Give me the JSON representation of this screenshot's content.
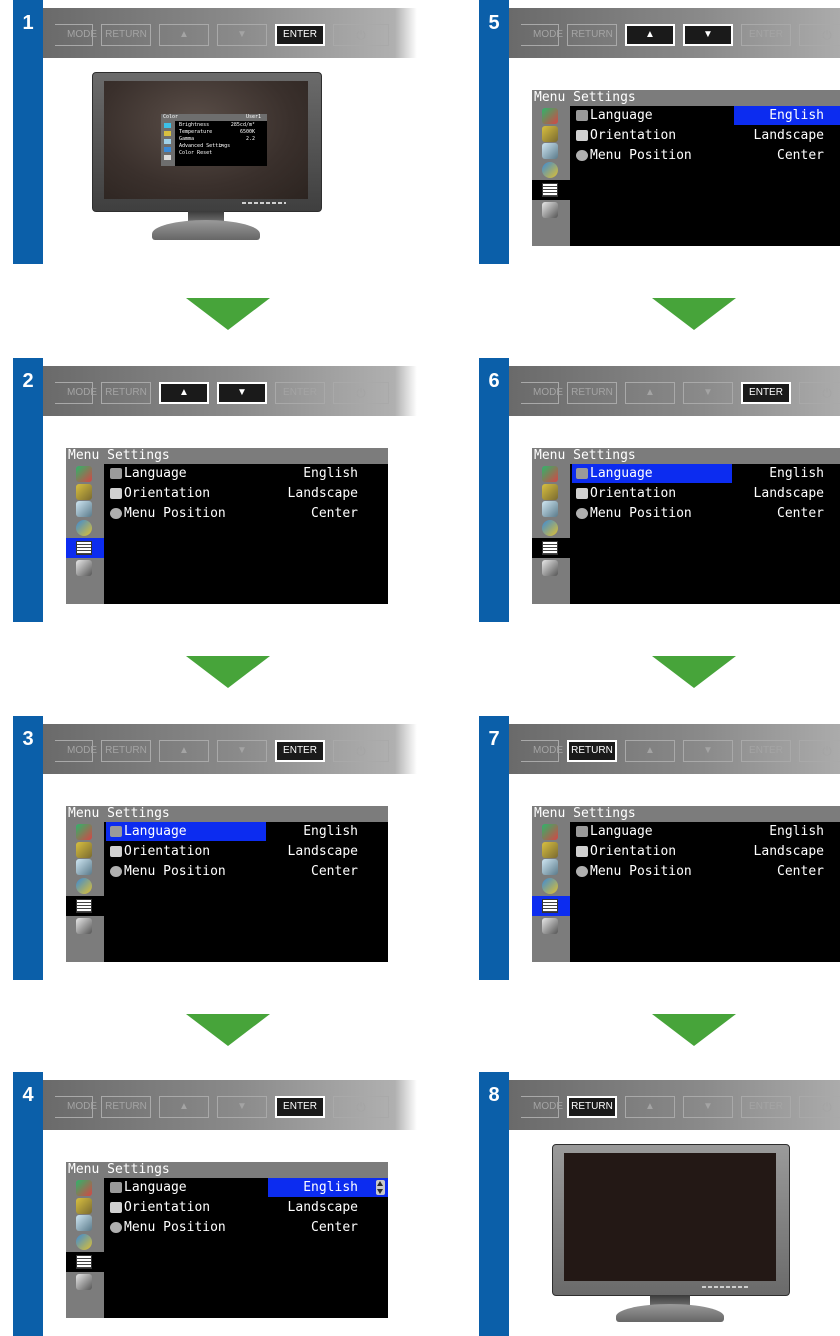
{
  "buttons": {
    "mode": "MODE",
    "return": "RETURN",
    "up": "▲",
    "down": "▼",
    "enter": "ENTER",
    "power": "⏻"
  },
  "menu": {
    "title": "Menu Settings",
    "rows": [
      {
        "label": "Language",
        "value": "English",
        "icon": "language-icon"
      },
      {
        "label": "Orientation",
        "value": "Landscape",
        "icon": "orientation-icon"
      },
      {
        "label": "Menu Position",
        "value": "Center",
        "icon": "menu-position-icon"
      }
    ]
  },
  "color_menu": {
    "title": "Color",
    "mode_value": "User1",
    "rows": [
      {
        "label": "Brightness",
        "value": "285cd/m²"
      },
      {
        "label": "Temperature",
        "value": "6500K"
      },
      {
        "label": "Gamma",
        "value": "2.2"
      },
      {
        "label": "Advanced Settings",
        "value": ">"
      },
      {
        "label": "Color Reset",
        "value": ""
      }
    ]
  },
  "steps": [
    {
      "number": "1",
      "active_button": "enter",
      "view": "monitor-color-menu"
    },
    {
      "number": "2",
      "active_button": "up-down",
      "view": "menu",
      "side_selected": true,
      "row_selected": false,
      "value_selected": false
    },
    {
      "number": "3",
      "active_button": "enter",
      "view": "menu",
      "side_selected": false,
      "row_selected": true,
      "value_selected": false
    },
    {
      "number": "4",
      "active_button": "enter",
      "view": "menu",
      "side_selected": false,
      "row_selected": false,
      "value_selected": true
    },
    {
      "number": "5",
      "active_button": "up-down",
      "view": "menu",
      "side_selected": false,
      "row_selected": false,
      "value_selected": true
    },
    {
      "number": "6",
      "active_button": "enter",
      "view": "menu",
      "side_selected": false,
      "row_selected": true,
      "value_selected": false
    },
    {
      "number": "7",
      "active_button": "return",
      "view": "menu",
      "side_selected": true,
      "row_selected": false,
      "value_selected": false
    },
    {
      "number": "8",
      "active_button": "return",
      "view": "monitor-blank"
    }
  ],
  "colors": {
    "step_band": "#0b5fa9",
    "highlight": "#0c2cf0",
    "arrow": "#47a43a",
    "osd_header": "#7c7c7c"
  }
}
